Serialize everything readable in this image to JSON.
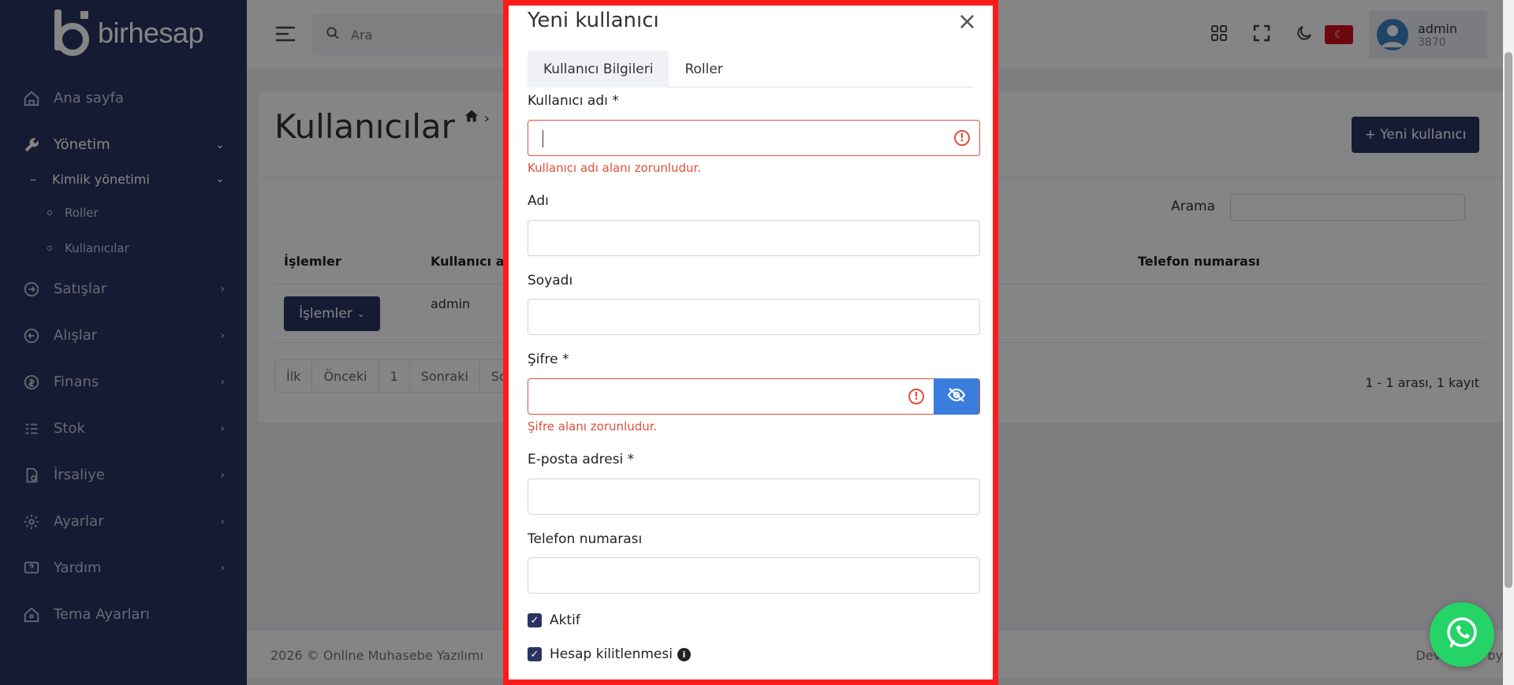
{
  "brand": {
    "name": "birhesap"
  },
  "sidebar": {
    "items": [
      {
        "label": "Ana sayfa",
        "icon": "home-icon"
      },
      {
        "label": "Yönetim",
        "icon": "wrench-icon"
      },
      {
        "label": "Kimlik yönetimi"
      },
      {
        "label": "Roller"
      },
      {
        "label": "Kullanıcılar"
      },
      {
        "label": "Satışlar",
        "icon": "sign-in-icon"
      },
      {
        "label": "Alışlar",
        "icon": "sign-out-icon"
      },
      {
        "label": "Finans",
        "icon": "coin-icon"
      },
      {
        "label": "Stok",
        "icon": "list-icon"
      },
      {
        "label": "İrsaliye",
        "icon": "document-icon"
      },
      {
        "label": "Ayarlar",
        "icon": "gear-icon"
      },
      {
        "label": "Yardım",
        "icon": "help-icon"
      },
      {
        "label": "Tema Ayarları",
        "icon": "home-settings-icon"
      }
    ]
  },
  "topbar": {
    "search_placeholder": "Ara",
    "user_name": "admin",
    "user_id": "3870"
  },
  "page": {
    "title": "Kullanıcılar",
    "new_button": "+ Yeni kullanıcı",
    "search_label": "Arama",
    "columns": [
      "İşlemler",
      "Kullanıcı adı",
      "Telefon numarası"
    ],
    "row": {
      "actions": "İşlemler",
      "username": "admin"
    },
    "pager": [
      "İlk",
      "Önceki",
      "1",
      "Sonraki",
      "Son"
    ],
    "record_info": "1 - 1 arası, 1 kayıt"
  },
  "footer": {
    "left": "2026 © Online Muhasebe Yazılımı",
    "right": "Developed by"
  },
  "modal": {
    "title": "Yeni kullanıcı",
    "tabs": [
      "Kullanıcı Bilgileri",
      "Roller"
    ],
    "fields": {
      "username_label": "Kullanıcı adı *",
      "username_error": "Kullanıcı adı alanı zorunludur.",
      "name_label": "Adı",
      "surname_label": "Soyadı",
      "password_label": "Şifre *",
      "password_error": "Şifre alanı zorunludur.",
      "email_label": "E-posta adresi *",
      "phone_label": "Telefon numarası"
    },
    "checkboxes": {
      "active": "Aktif",
      "lockout": "Hesap kilitlenmesi"
    }
  },
  "colors": {
    "sidebar": "#2a3462",
    "primary": "#2a3462",
    "error": "#e04f3a",
    "highlight": "#ff1b1b",
    "eye_button": "#3b7ddd"
  }
}
